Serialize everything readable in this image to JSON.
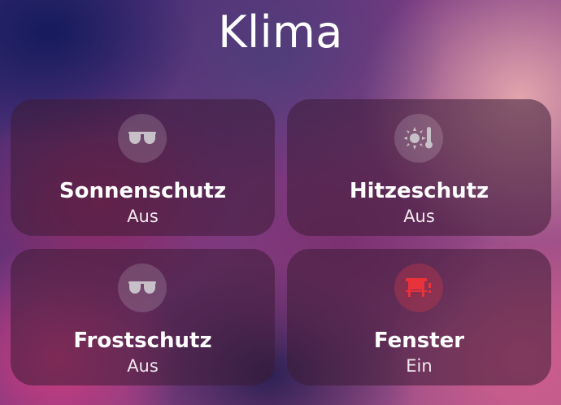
{
  "title": "Klima",
  "tiles": [
    {
      "name": "Sonnenschutz",
      "state": "Aus",
      "icon": "sunglasses-icon",
      "active": false
    },
    {
      "name": "Hitzeschutz",
      "state": "Aus",
      "icon": "sun-thermometer-icon",
      "active": false
    },
    {
      "name": "Frostschutz",
      "state": "Aus",
      "icon": "sunglasses-icon",
      "active": false
    },
    {
      "name": "Fenster",
      "state": "Ein",
      "icon": "window-icon",
      "active": true
    }
  ],
  "colors": {
    "icon_inactive": "#c8c0c8",
    "icon_active": "#e8333b"
  }
}
